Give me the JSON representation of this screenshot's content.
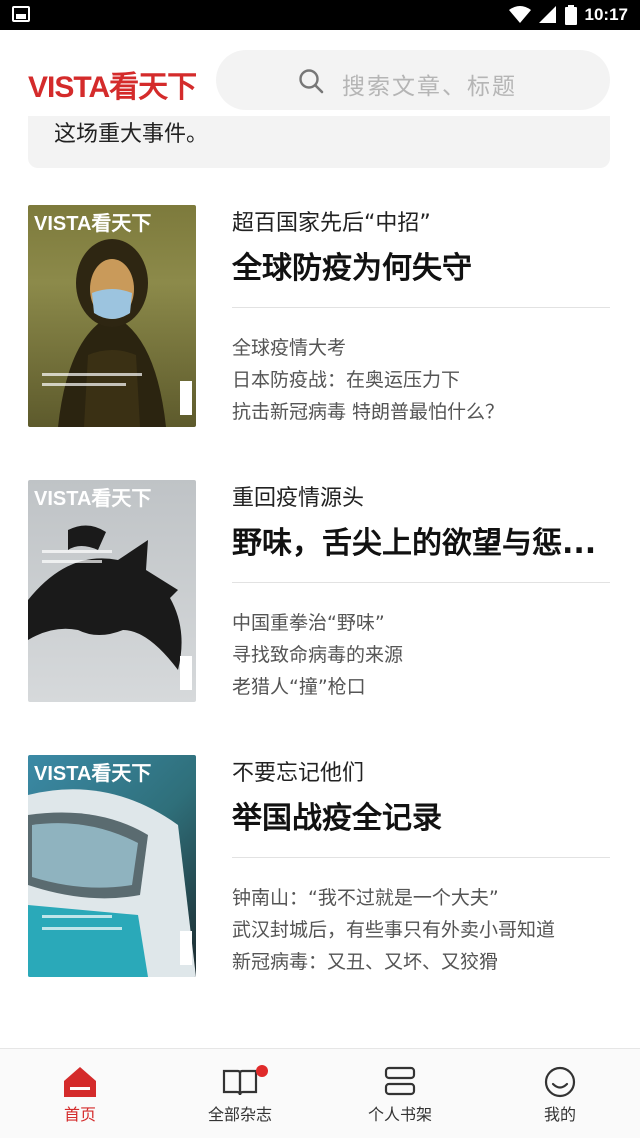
{
  "status_bar": {
    "time": "10:17"
  },
  "header": {
    "logo": "VISTA看天下",
    "search_placeholder": "搜索文章、标题",
    "search_icon": "search-icon"
  },
  "banner_tail_text": "这场重大事件。",
  "magazines": [
    {
      "cover_masthead": "VISTA看天下",
      "cover_description": "Mona Lisa wearing a surgical mask",
      "subtitle": "超百国家先后“中招”",
      "title": "全球防疫为何失守",
      "articles": [
        "全球疫情大考",
        "日本防疫战：在奥运压力下",
        "抗击新冠病毒 特朗普最怕什么？"
      ]
    },
    {
      "cover_masthead": "VISTA看天下",
      "cover_description": "Bat silhouette on grey background",
      "subtitle": "重回疫情源头",
      "title": "野味，舌尖上的欲望与惩...",
      "articles": [
        "中国重拳治“野味”",
        "寻找致命病毒的来源",
        "老猎人“撞”枪口"
      ]
    },
    {
      "cover_masthead": "VISTA看天下",
      "cover_description": "Medical worker in protective goggles",
      "subtitle": "不要忘记他们",
      "title": "举国战疫全记录",
      "articles": [
        "钟南山：“我不过就是一个大夫”",
        "武汉封城后，有些事只有外卖小哥知道",
        "新冠病毒：又丑、又坏、又狡猾"
      ]
    }
  ],
  "tabs": [
    {
      "label": "首页",
      "icon": "home-icon",
      "active": true
    },
    {
      "label": "全部杂志",
      "icon": "book-icon",
      "badge": true
    },
    {
      "label": "个人书架",
      "icon": "bookshelf-icon"
    },
    {
      "label": "我的",
      "icon": "smiley-icon"
    }
  ],
  "colors": {
    "brand": "#d42b2b",
    "badge": "#e02a2a",
    "search_bg": "#f3f3f3"
  }
}
